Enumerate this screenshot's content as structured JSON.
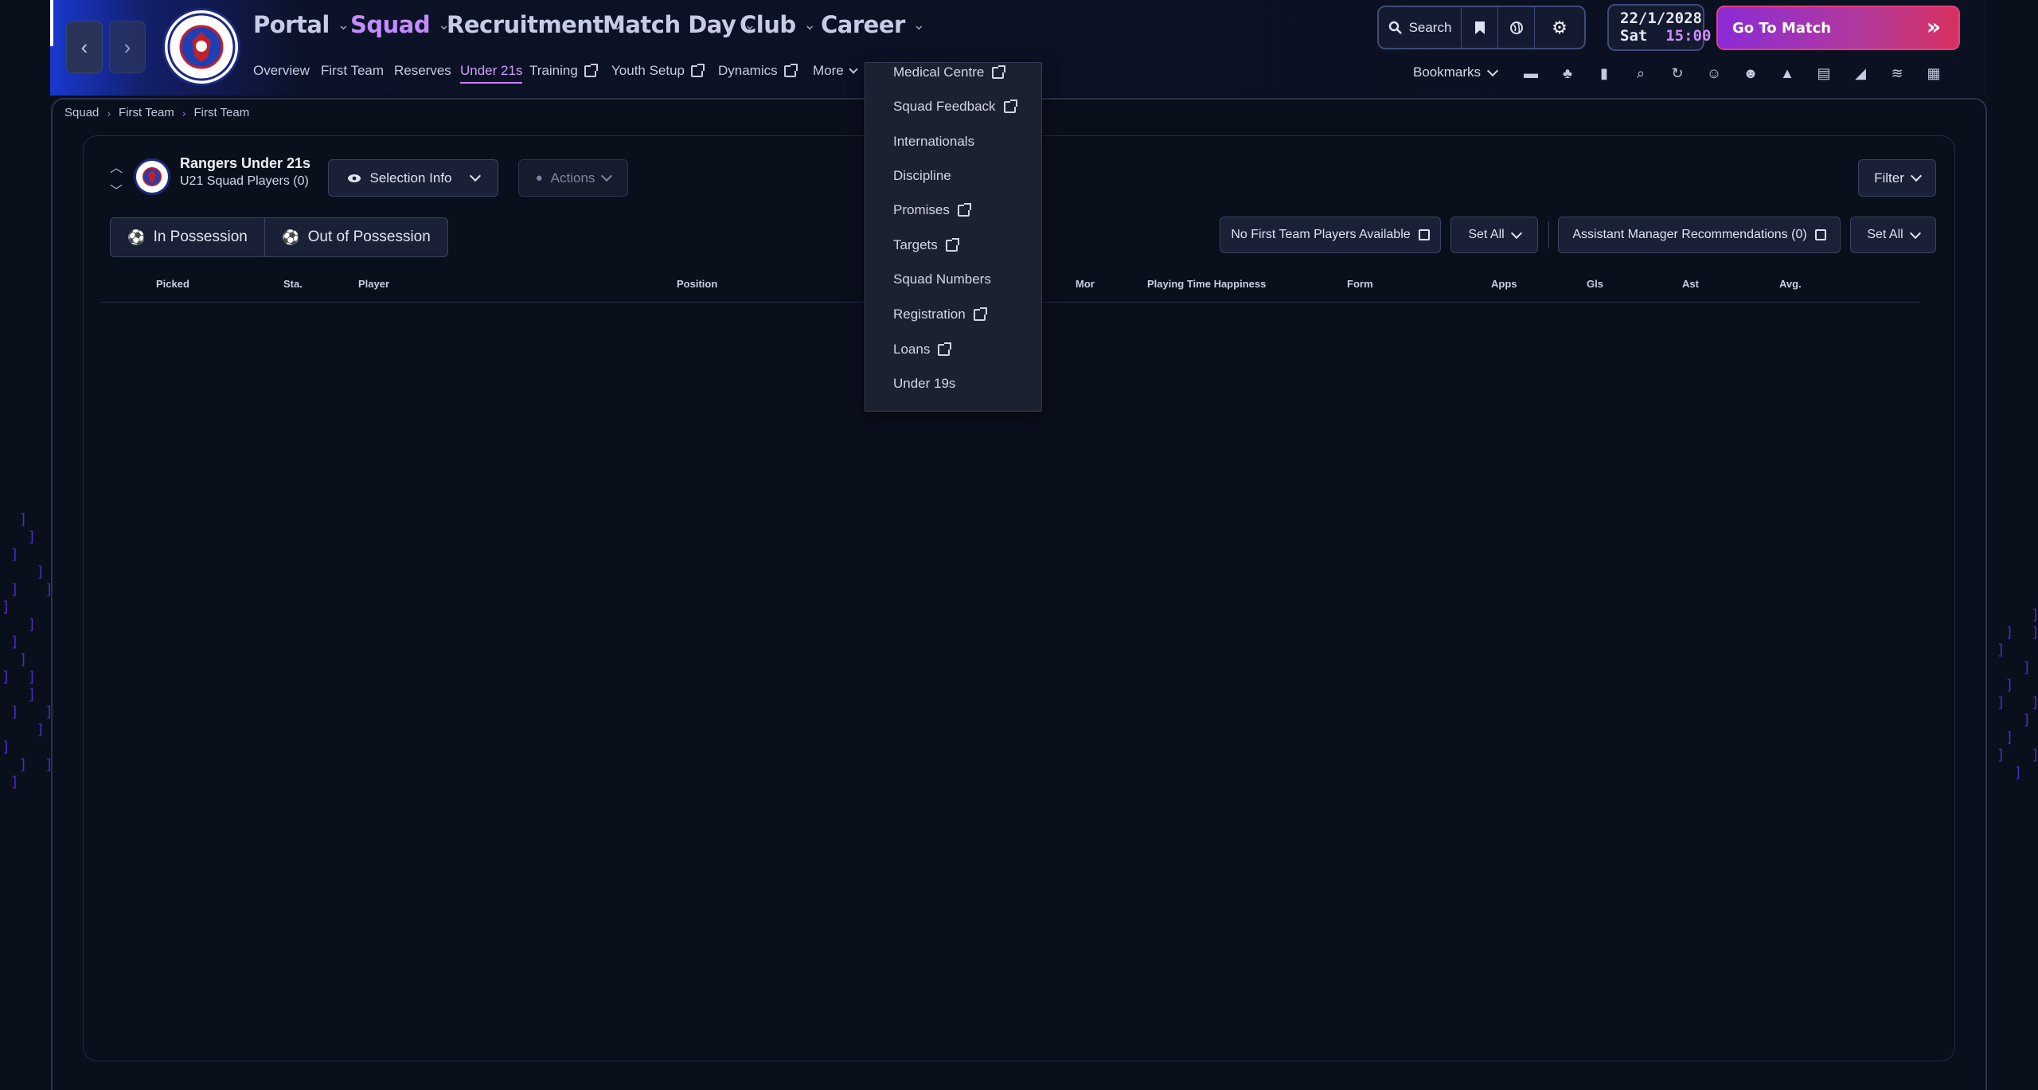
{
  "nav": {
    "main": [
      {
        "label": "Portal"
      },
      {
        "label": "Squad"
      },
      {
        "label": "Recruitment"
      },
      {
        "label": "Match Day"
      },
      {
        "label": "Club"
      },
      {
        "label": "Career"
      }
    ],
    "sub": [
      {
        "label": "Overview"
      },
      {
        "label": "First Team"
      },
      {
        "label": "Reserves"
      },
      {
        "label": "Under 21s"
      },
      {
        "label": "Training"
      },
      {
        "label": "Youth Setup"
      },
      {
        "label": "Dynamics"
      },
      {
        "label": "More"
      }
    ]
  },
  "topbar": {
    "search_label": "Search",
    "date": "22/1/2028",
    "day": "Sat",
    "time": "15:00",
    "go_to_match": "Go To Match",
    "bookmarks": "Bookmarks"
  },
  "logo_text": "RANGERS FOOTBALL CLUB",
  "breadcrumb": [
    "Squad",
    "First Team",
    "First Team"
  ],
  "team": {
    "name": "Rangers Under 21s",
    "subtitle": "U21 Squad Players (0)"
  },
  "controls": {
    "selection_info": "Selection Info",
    "actions": "Actions",
    "filter": "Filter",
    "in_possession": "In Possession",
    "out_of_possession": "Out of Possession",
    "no_first_team": "No First Team Players Available",
    "set_all_1": "Set All",
    "assistant_recs": "Assistant Manager Recommendations (0)",
    "set_all_2": "Set All"
  },
  "table": {
    "columns": [
      "Picked",
      "Sta.",
      "Player",
      "Position",
      "Mor",
      "Playing Time Happiness",
      "Form",
      "Apps",
      "Gls",
      "Ast",
      "Avg."
    ],
    "rows": []
  },
  "dropdown": {
    "items": [
      {
        "label": "Medical Centre",
        "external": true
      },
      {
        "label": "Squad Feedback",
        "external": true
      },
      {
        "label": "Internationals",
        "external": false
      },
      {
        "label": "Discipline",
        "external": false
      },
      {
        "label": "Promises",
        "external": true
      },
      {
        "label": "Targets",
        "external": true
      },
      {
        "label": "Squad Numbers",
        "external": false
      },
      {
        "label": "Registration",
        "external": true
      },
      {
        "label": "Loans",
        "external": true
      },
      {
        "label": "Under 19s",
        "external": false
      }
    ]
  },
  "colors": {
    "accent": "#c38cff",
    "background": "#0a0f1c",
    "go_to_match_start": "#8b2bd6",
    "go_to_match_end": "#d8305f"
  }
}
